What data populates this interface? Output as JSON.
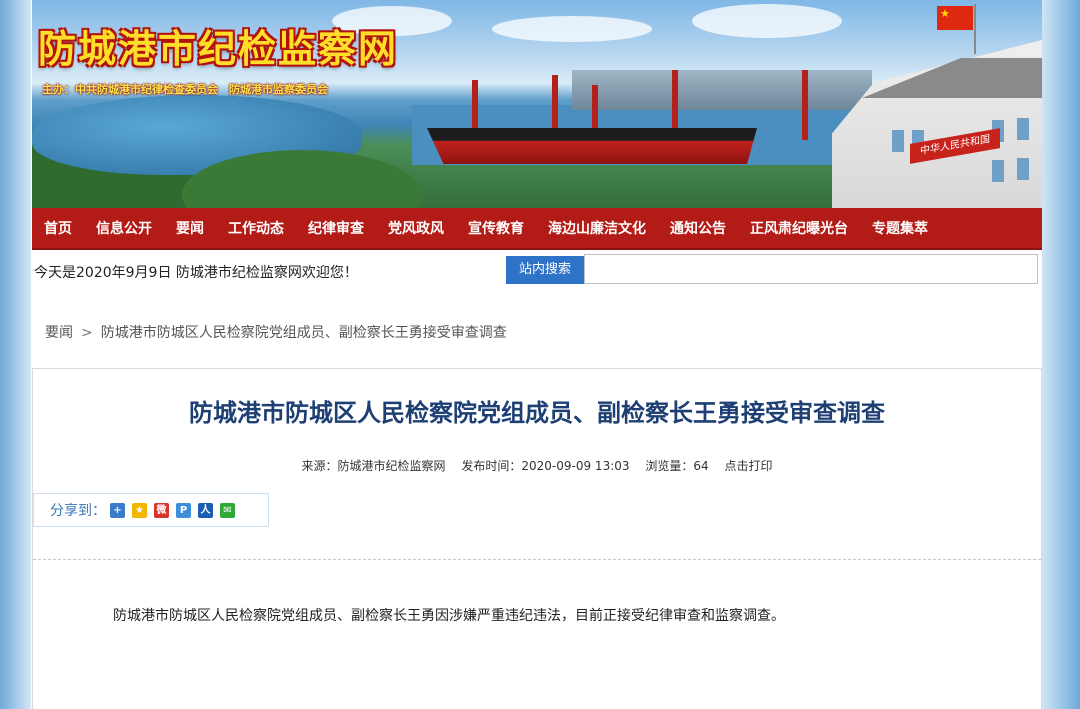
{
  "header": {
    "site_title": "防城港市纪检监察网",
    "sponsor": "主办：中共防城港市纪律检查委员会　防城港市监察委员会",
    "building_plate": "中华人民共和国"
  },
  "nav": {
    "items": [
      "首页",
      "信息公开",
      "要闻",
      "工作动态",
      "纪律审查",
      "党风政风",
      "宣传教育",
      "海边山廉洁文化",
      "通知公告",
      "正风肃纪曝光台",
      "专题集萃"
    ]
  },
  "welcome_text": "今天是2020年9月9日 防城港市纪检监察网欢迎您！",
  "search": {
    "button_label": "站内搜索",
    "value": "",
    "placeholder": ""
  },
  "breadcrumb": {
    "parent": "要闻",
    "separator": ">",
    "current": "防城港市防城区人民检察院党组成员、副检察长王勇接受审查调查"
  },
  "article": {
    "title": "防城港市防城区人民检察院党组成员、副检察长王勇接受审查调查",
    "source": "来源：防城港市纪检监察网",
    "publish_time": "发布时间：2020-09-09 13:03",
    "views": "浏览量：64",
    "print_label": "点击打印",
    "body": "防城港市防城区人民检察院党组成员、副检察长王勇因涉嫌严重违纪违法，目前正接受纪律审查和监察调查。"
  },
  "share": {
    "label": "分享到：",
    "icons": [
      {
        "name": "more-share-icon",
        "color": "#3a7cc9",
        "glyph": "+"
      },
      {
        "name": "qzone-icon",
        "color": "#f2b600",
        "glyph": "★"
      },
      {
        "name": "weibo-icon",
        "color": "#d9342b",
        "glyph": "微"
      },
      {
        "name": "tencent-weibo-icon",
        "color": "#3c8ed8",
        "glyph": "P"
      },
      {
        "name": "renren-icon",
        "color": "#1c5fb0",
        "glyph": "人"
      },
      {
        "name": "wechat-icon",
        "color": "#2fa836",
        "glyph": "✉"
      }
    ]
  },
  "colors": {
    "nav_bg": "#b31b16",
    "title_color": "#1e3f73",
    "search_button_bg": "#2f73c9"
  }
}
